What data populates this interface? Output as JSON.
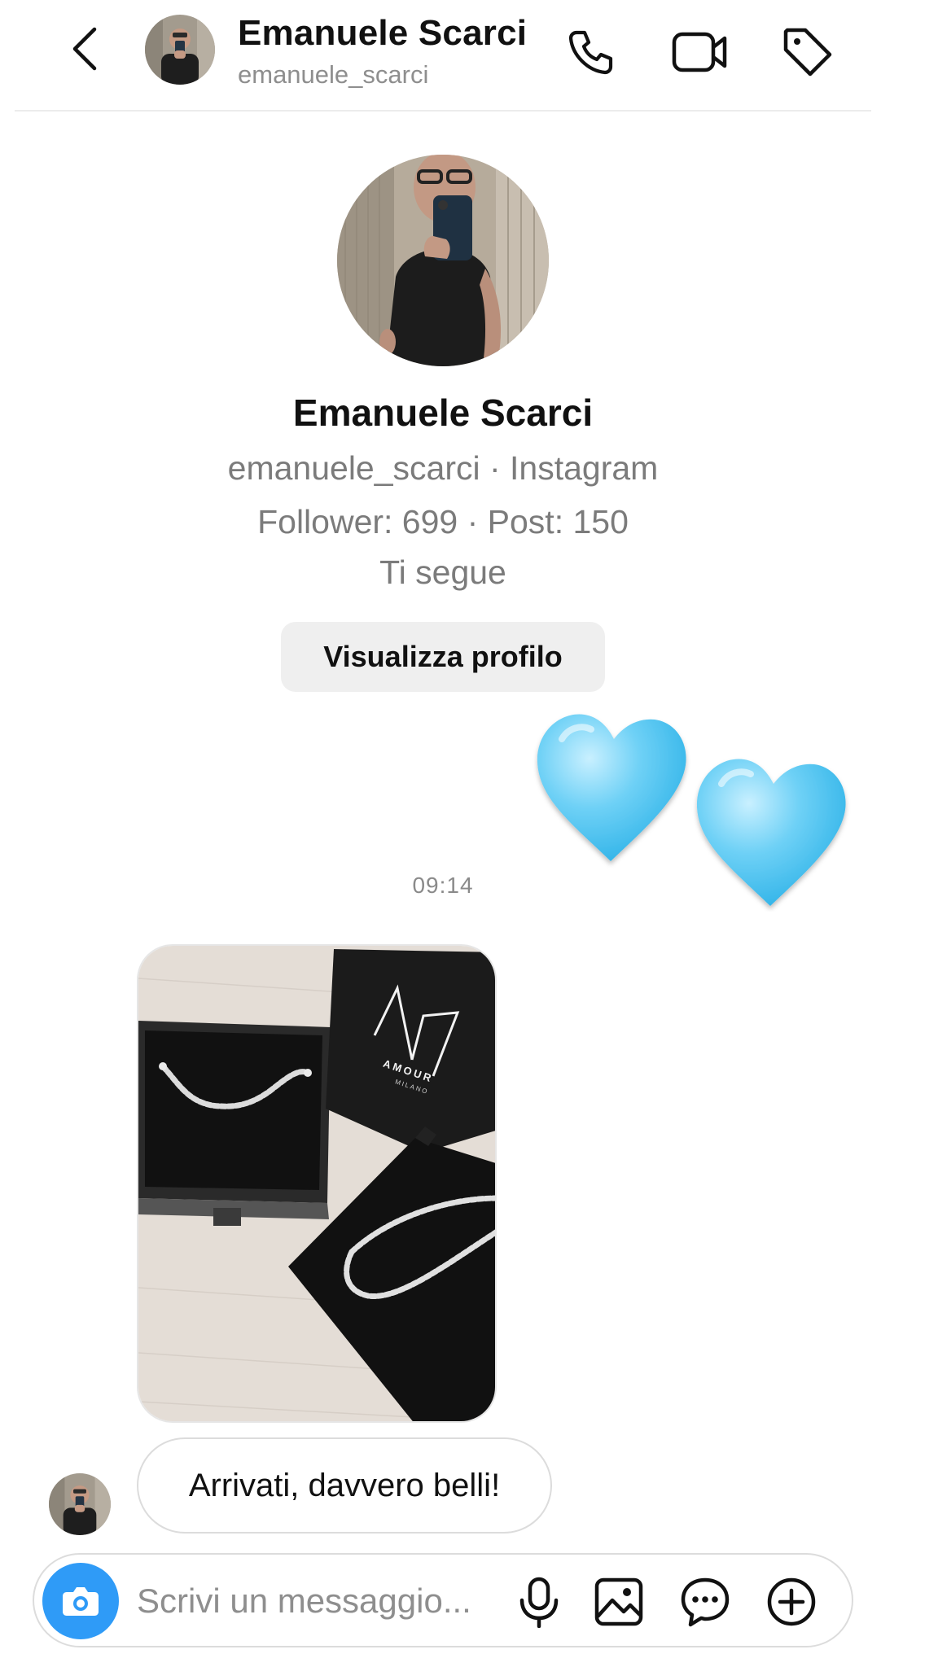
{
  "header": {
    "name": "Emanuele Scarci",
    "handle": "emanuele_scarci",
    "icons": [
      "back-chevron-icon",
      "phone-icon",
      "video-camera-icon",
      "tag-icon"
    ]
  },
  "profile": {
    "name": "Emanuele Scarci",
    "handle_line": "emanuele_scarci · Instagram",
    "stats_line": "Follower: 699 · Post: 150",
    "follow_status": "Ti segue",
    "view_profile_label": "Visualizza profilo"
  },
  "messages": {
    "hearts": {
      "count": 2,
      "color": "#5ccbf3",
      "icon": "blue-heart-emoji"
    },
    "timestamp": "09:14",
    "photo": {
      "brand_logo_text": "AMOUR",
      "brand_logo_subtext": "MILANO"
    },
    "text": "Arrivati, davvero belli!"
  },
  "composer": {
    "placeholder": "Scrivi un messaggio...",
    "value": "",
    "icons": [
      "camera-icon",
      "microphone-icon",
      "gallery-icon",
      "sticker-icon",
      "plus-icon"
    ]
  },
  "colors": {
    "accent": "#2f9bf7",
    "secondary_text": "#7b7b7b",
    "button_bg": "#efefef",
    "divider": "#ececec"
  }
}
